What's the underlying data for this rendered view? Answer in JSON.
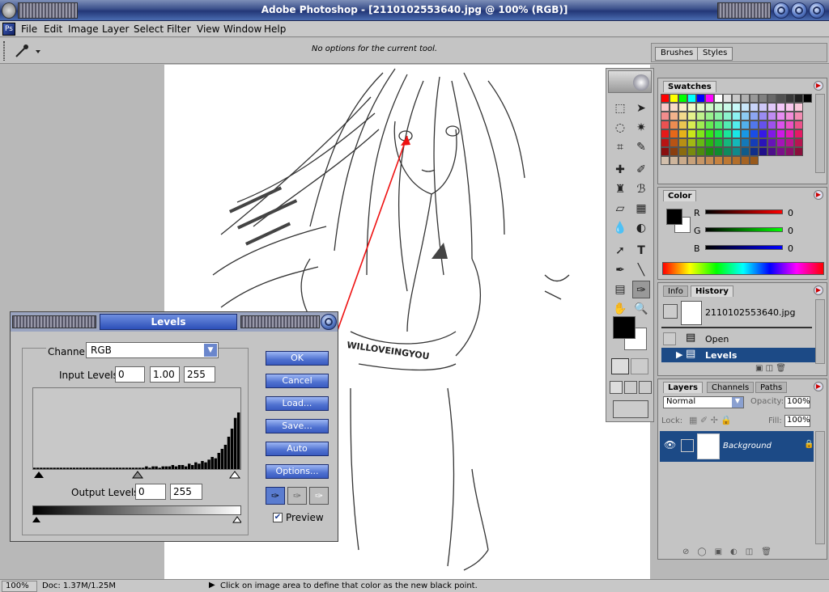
{
  "window": {
    "title": "Adobe Photoshop - [2110102553640.jpg @ 100% (RGB)]"
  },
  "menu": [
    "File",
    "Edit",
    "Image",
    "Layer",
    "Select",
    "Filter",
    "View",
    "Window",
    "Help"
  ],
  "options_bar": {
    "text": "No options for the current tool.",
    "tool_icon": "eyedropper-icon"
  },
  "palette_well": {
    "tabs": [
      "Brushes",
      "Styles"
    ]
  },
  "swatches": {
    "tab": "Swatches",
    "colors": [
      "#ff0000",
      "#ffff00",
      "#00ff00",
      "#00ffff",
      "#0000ff",
      "#ff00ff",
      "#ffffff",
      "#e0e0e0",
      "#c8c8c8",
      "#b0b0b0",
      "#989898",
      "#808080",
      "#686868",
      "#505050",
      "#383838",
      "#202020",
      "#000000"
    ]
  },
  "color": {
    "tab": "Color",
    "channels": [
      {
        "name": "R",
        "value": "0"
      },
      {
        "name": "G",
        "value": "0"
      },
      {
        "name": "B",
        "value": "0"
      }
    ]
  },
  "history": {
    "tabs": [
      "Info",
      "History"
    ],
    "snapshot": "2110102553640.jpg",
    "items": [
      "Open",
      "Levels"
    ]
  },
  "layers": {
    "tabs": [
      "Layers",
      "Channels",
      "Paths"
    ],
    "blend_mode": "Normal",
    "opacity_label": "Opacity:",
    "opacity": "100%",
    "lock_label": "Lock:",
    "fill_label": "Fill:",
    "fill": "100%",
    "layer_name": "Background"
  },
  "levels": {
    "title": "Levels",
    "channel_label": "Channel:",
    "channel": "RGB",
    "input_label": "Input Levels:",
    "input_values": [
      "0",
      "1.00",
      "255"
    ],
    "output_label": "Output Levels:",
    "output_values": [
      "0",
      "255"
    ],
    "buttons": [
      "OK",
      "Cancel",
      "Load...",
      "Save...",
      "Auto",
      "Options..."
    ],
    "preview_label": "Preview",
    "preview_checked": true,
    "histogram": [
      1,
      1,
      1,
      1,
      1,
      1,
      1,
      1,
      1,
      1,
      1,
      1,
      1,
      1,
      1,
      1,
      1,
      1,
      1,
      1,
      1,
      1,
      1,
      1,
      1,
      1,
      1,
      1,
      1,
      1,
      1,
      1,
      1,
      1,
      2,
      1,
      2,
      2,
      1,
      2,
      2,
      2,
      3,
      2,
      3,
      3,
      2,
      4,
      3,
      5,
      4,
      6,
      5,
      7,
      9,
      8,
      12,
      15,
      18,
      24,
      30,
      38,
      42
    ]
  },
  "canvas": {
    "caption": "WILLOVEINGYOU"
  },
  "status": {
    "zoom": "100%",
    "doc": "Doc: 1.37M/1.25M",
    "hint": "Click on image area to define that color as the new black point."
  }
}
